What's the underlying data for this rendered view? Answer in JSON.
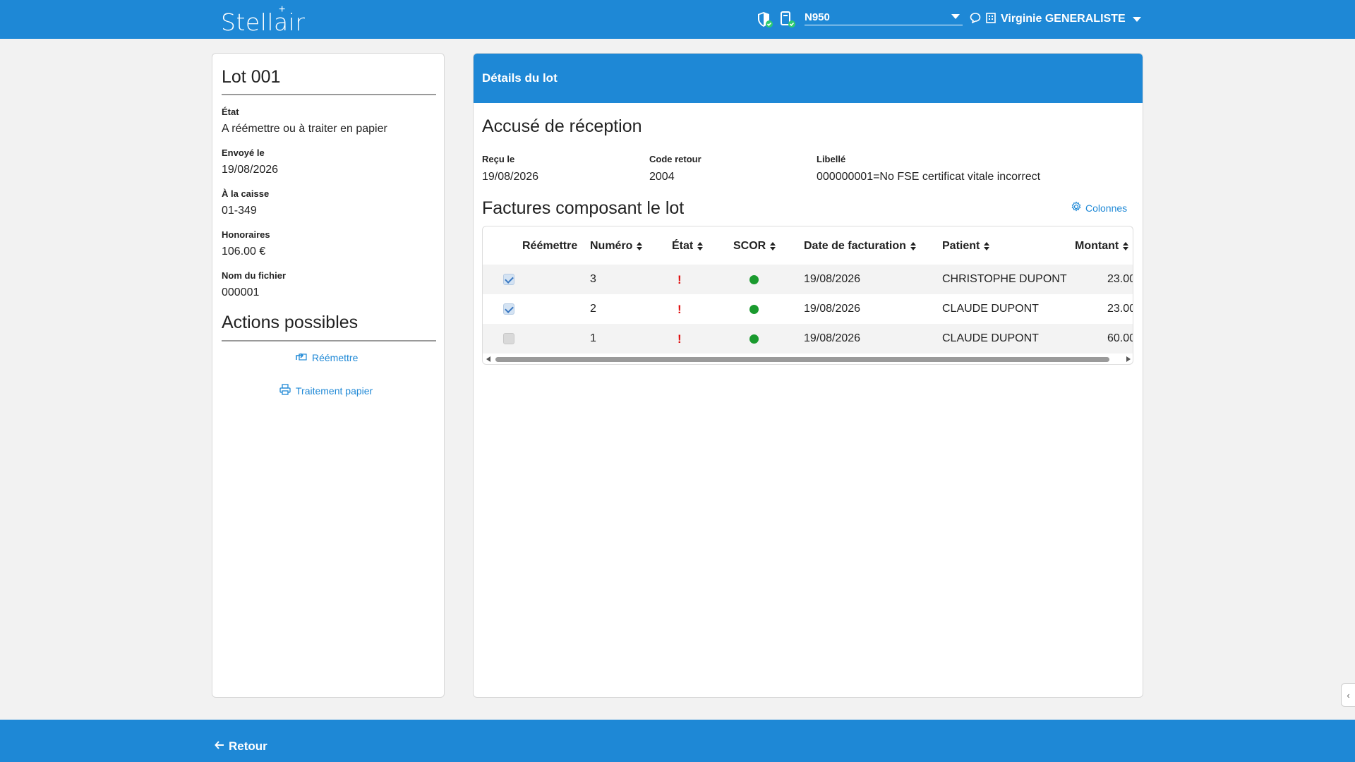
{
  "app": {
    "logo_text": "Stellair"
  },
  "header": {
    "device": "N950",
    "user": "Virginie GENERALISTE",
    "icons": [
      "shield-check-icon",
      "card-reader-icon",
      "chat-icon",
      "building-icon"
    ]
  },
  "lot": {
    "title": "Lot 001",
    "fields": [
      {
        "label": "État",
        "value": "A réémettre ou à traiter en papier"
      },
      {
        "label": "Envoyé le",
        "value": "19/08/2026"
      },
      {
        "label": "À la caisse",
        "value": "01-349"
      },
      {
        "label": "Honoraires",
        "value": "106.00 €"
      },
      {
        "label": "Nom du fichier",
        "value": "000001"
      }
    ]
  },
  "actions": {
    "title": "Actions possibles",
    "items": [
      {
        "label": "Réémettre",
        "icon": "resend-icon"
      },
      {
        "label": "Traitement papier",
        "icon": "printer-icon"
      }
    ]
  },
  "details": {
    "header_title": "Détails du lot",
    "ack": {
      "title": "Accusé de réception",
      "labels": [
        "Reçu le",
        "Code retour",
        "Libellé"
      ],
      "values": [
        "19/08/2026",
        "2004",
        "000000001=No FSE certificat vitale incorrect"
      ]
    },
    "invoices": {
      "title": "Factures composant le lot",
      "columns_link": "Colonnes",
      "columns": [
        "Réémettre",
        "Numéro",
        "État",
        "SCOR",
        "Date de facturation",
        "Patient",
        "Montant"
      ],
      "rows": [
        {
          "reemit": true,
          "numero": "3",
          "etat": "!",
          "scor": "ok",
          "date": "19/08/2026",
          "patient": "CHRISTOPHE DUPONT",
          "montant": "23.00"
        },
        {
          "reemit": true,
          "numero": "2",
          "etat": "!",
          "scor": "ok",
          "date": "19/08/2026",
          "patient": "CLAUDE DUPONT",
          "montant": "23.00"
        },
        {
          "reemit": false,
          "numero": "1",
          "etat": "!",
          "scor": "ok",
          "date": "19/08/2026",
          "patient": "CLAUDE DUPONT",
          "montant": "60.00"
        }
      ]
    }
  },
  "footer": {
    "back_label": "Retour"
  },
  "colors": {
    "primary": "#1e88d6",
    "warning": "#e01010",
    "success": "#1a9a2e"
  }
}
